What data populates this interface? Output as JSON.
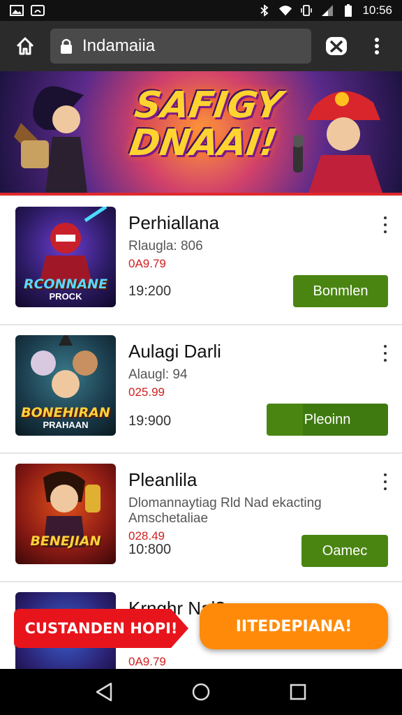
{
  "status_bar": {
    "time": "10:56",
    "icons": [
      "image-icon",
      "cast-icon",
      "bluetooth-icon",
      "wifi-icon",
      "vibrate-icon",
      "signal-icon",
      "battery-icon"
    ]
  },
  "toolbar": {
    "url": "Indamaiia",
    "icons": [
      "home-icon",
      "lock-icon",
      "game-controller-icon",
      "more-vert-icon"
    ]
  },
  "banner": {
    "title_line1": "SAFIGY",
    "title_line2": "DNAAI!"
  },
  "items": [
    {
      "title": "Perhiallana",
      "subtitle": "Rlaugla: 806",
      "price": "0A9.79",
      "time": "19:200",
      "button": "Bonmlen",
      "thumb_caption": "RCONNANE",
      "thumb_sub": "PROCK"
    },
    {
      "title": "Aulagi Darli",
      "subtitle": "Alaugl: 94",
      "price": "025.99",
      "time": "19:900",
      "button": "Pleoinn",
      "thumb_caption": "BONEHIRAN",
      "thumb_sub": "PRAHAAN"
    },
    {
      "title": "Pleanlila",
      "subtitle": "Dlomannaytiag Rld Nad ekacting Amschetaliae",
      "price": "028.49",
      "time": "10:800",
      "button": "Oamec",
      "thumb_caption": "BENEJIAN",
      "thumb_sub": ""
    },
    {
      "title": "Krnghr Nal?",
      "subtitle": "",
      "price": "0A9.79",
      "time": "",
      "button": "",
      "thumb_caption": "",
      "thumb_sub": ""
    }
  ],
  "promo": {
    "left_label": "CUSTANDEN HOPI!",
    "right_label": "IITEDEPIANA!"
  },
  "nav": {
    "icons": [
      "back-icon",
      "home-circle-icon",
      "recents-icon"
    ]
  },
  "colors": {
    "accent_green": "#4a8512",
    "price_red": "#d02020",
    "promo_red": "#e8141c",
    "promo_orange": "#ff8a0a"
  }
}
